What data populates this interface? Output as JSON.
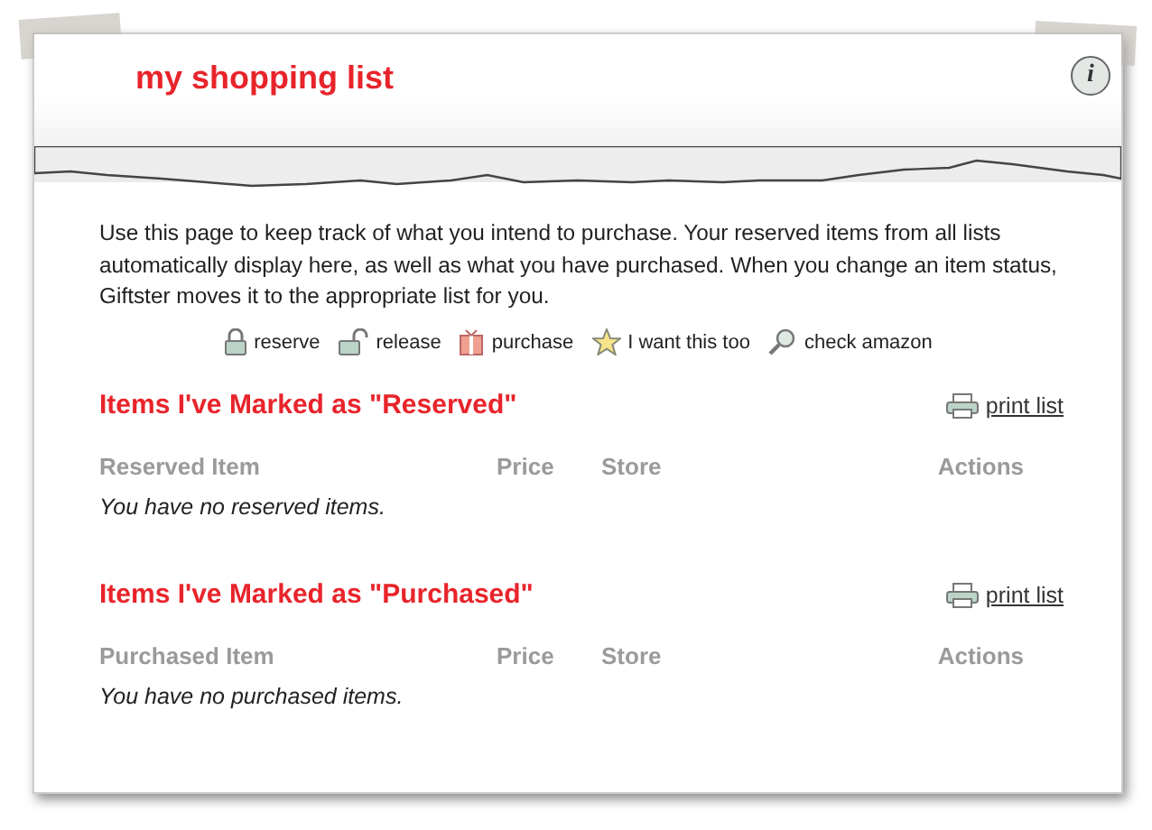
{
  "header": {
    "title": "my shopping list",
    "info_icon": "i"
  },
  "intro": "Use this page to keep track of what you intend to purchase. Your reserved items from all lists automatically display here, as well as what you have purchased. When you change an item status, Giftster moves it to the appropriate list for you.",
  "legend": [
    {
      "kind": "lock",
      "label": "reserve"
    },
    {
      "kind": "unlock",
      "label": "release"
    },
    {
      "kind": "gift",
      "label": "purchase"
    },
    {
      "kind": "star",
      "label": "I want this too"
    },
    {
      "kind": "search",
      "label": "check amazon"
    }
  ],
  "sections": [
    {
      "title": "Items I've Marked as \"Reserved\"",
      "print_link": "print list",
      "columns": [
        "Reserved Item",
        "Price",
        "Store",
        "Actions"
      ],
      "empty_message": "You have no reserved items."
    },
    {
      "title": "Items I've Marked as \"Purchased\"",
      "print_link": "print list",
      "columns": [
        "Purchased Item",
        "Price",
        "Store",
        "Actions"
      ],
      "empty_message": "You have no purchased items."
    }
  ]
}
